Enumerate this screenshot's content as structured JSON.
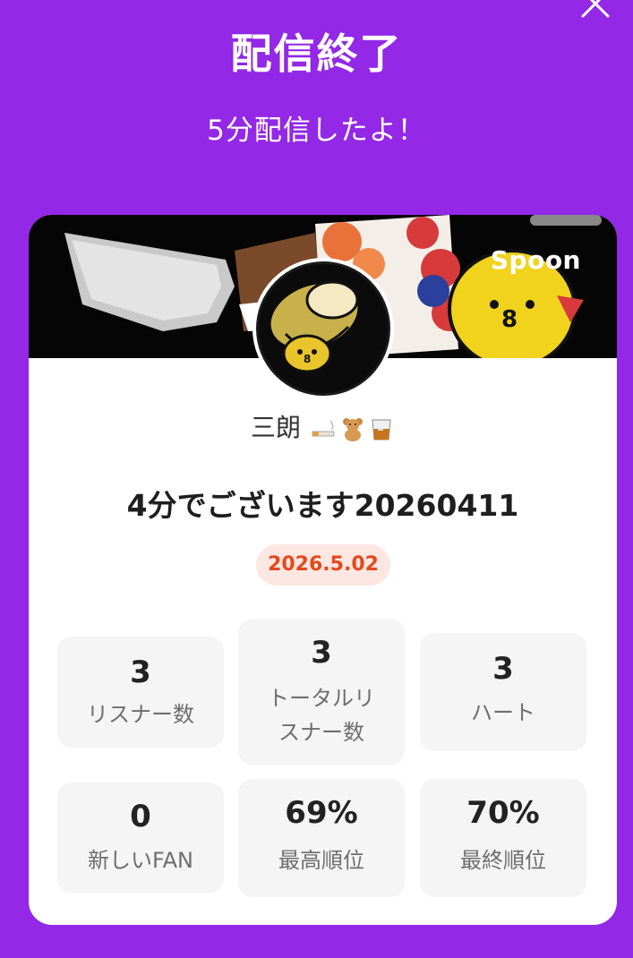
{
  "header": {
    "title": "配信終了",
    "subtitle": "5分配信したよ！"
  },
  "card": {
    "brand": "Spoon",
    "username": "三朗",
    "username_emojis": [
      "cigarette-icon",
      "teddy-bear-icon",
      "whisky-glass-icon"
    ],
    "stream_title": "4分でございます20260411",
    "date": "2026.5.02"
  },
  "stats": [
    {
      "value": "3",
      "label": "リスナー数"
    },
    {
      "value": "3",
      "label_line1": "トータルリ",
      "label_line2": "スナー数"
    },
    {
      "value": "3",
      "label": "ハート"
    },
    {
      "value": "0",
      "label": "新しいFAN"
    },
    {
      "value": "69%",
      "label": "最高順位"
    },
    {
      "value": "70%",
      "label": "最終順位"
    }
  ],
  "colors": {
    "background": "#9328e6",
    "date_badge_bg": "#fde7e2",
    "date_badge_text": "#e24a1c",
    "stat_box": "#f5f5f5"
  }
}
